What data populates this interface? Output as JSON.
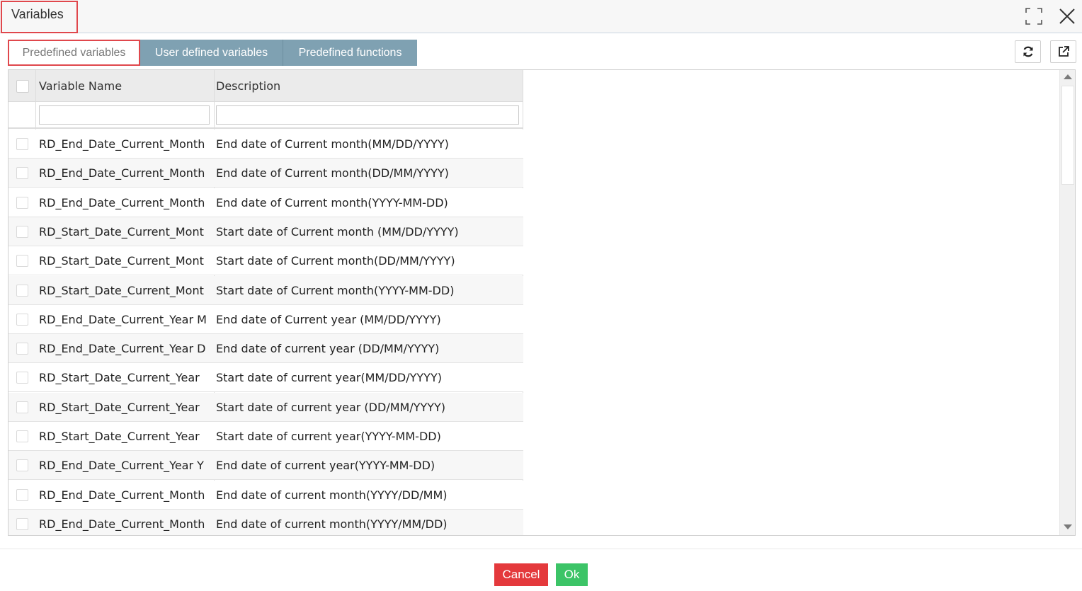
{
  "dialog": {
    "title": "Variables"
  },
  "tabs": [
    {
      "label": "Predefined variables",
      "active": true
    },
    {
      "label": "User defined variables",
      "active": false
    },
    {
      "label": "Predefined functions",
      "active": false
    }
  ],
  "toolbar": {
    "refresh_icon": "refresh-icon",
    "popout_icon": "external-link-icon"
  },
  "grid": {
    "columns": [
      "Variable Name",
      "Description"
    ],
    "filters": {
      "name": "",
      "description": ""
    },
    "rows": [
      {
        "name": "RD_End_Date_Current_Month",
        "description": "End date of Current month(MM/DD/YYYY)"
      },
      {
        "name": "RD_End_Date_Current_Month",
        "description": "End date of Current month(DD/MM/YYYY)"
      },
      {
        "name": "RD_End_Date_Current_Month",
        "description": "End date of Current month(YYYY-MM-DD)"
      },
      {
        "name": "RD_Start_Date_Current_Mont",
        "description": "Start date of Current month (MM/DD/YYYY)"
      },
      {
        "name": "RD_Start_Date_Current_Mont",
        "description": "Start date of Current month(DD/MM/YYYY)"
      },
      {
        "name": "RD_Start_Date_Current_Mont",
        "description": "Start date of Current month(YYYY-MM-DD)"
      },
      {
        "name": "RD_End_Date_Current_Year M",
        "description": "End date of Current year (MM/DD/YYYY)"
      },
      {
        "name": "RD_End_Date_Current_Year D",
        "description": "End date of current year (DD/MM/YYYY)"
      },
      {
        "name": "RD_Start_Date_Current_Year",
        "description": "Start date of current year(MM/DD/YYYY)"
      },
      {
        "name": "RD_Start_Date_Current_Year",
        "description": "Start date of current year (DD/MM/YYYY)"
      },
      {
        "name": "RD_Start_Date_Current_Year",
        "description": "Start date of current year(YYYY-MM-DD)"
      },
      {
        "name": "RD_End_Date_Current_Year Y",
        "description": "End date of current year(YYYY-MM-DD)"
      },
      {
        "name": "RD_End_Date_Current_Month",
        "description": "End date of current month(YYYY/DD/MM)"
      },
      {
        "name": "RD_End_Date_Current_Month",
        "description": "End date of current month(YYYY/MM/DD)"
      }
    ]
  },
  "footer": {
    "cancel_label": "Cancel",
    "ok_label": "Ok"
  },
  "colors": {
    "tab_inactive": "#7fa1b2",
    "highlight_border": "#e0474c",
    "cancel": "#e4393c",
    "ok": "#3cc467"
  }
}
